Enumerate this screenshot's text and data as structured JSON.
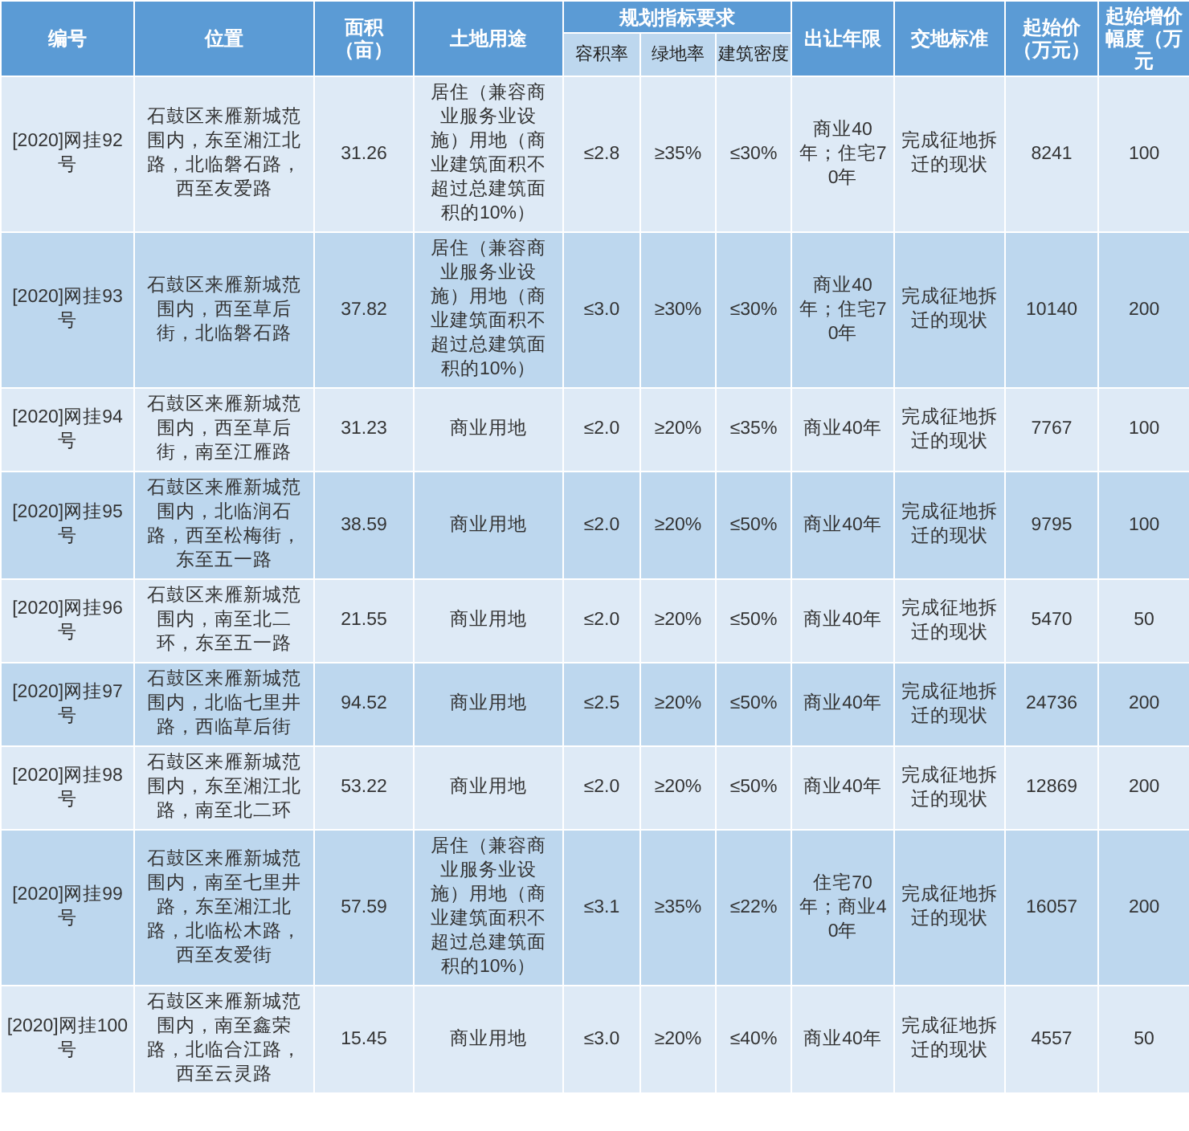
{
  "table": {
    "header_rows": [
      [
        {
          "label": "编号",
          "rowspan": 2
        },
        {
          "label": "位置",
          "rowspan": 2
        },
        {
          "label": "面积（亩）",
          "rowspan": 2
        },
        {
          "label": "土地用途",
          "rowspan": 2
        },
        {
          "label": "规划指标要求",
          "colspan": 3
        },
        {
          "label": "出让年限",
          "rowspan": 2
        },
        {
          "label": "交地标准",
          "rowspan": 2
        },
        {
          "label": "起始价（万元）",
          "rowspan": 2
        },
        {
          "label": "起始增价幅度（万元",
          "rowspan": 2
        }
      ],
      [
        {
          "label": "容积率"
        },
        {
          "label": "绿地率"
        },
        {
          "label": "建筑密度"
        }
      ]
    ],
    "rows": [
      {
        "cells": [
          "[2020]网挂92号",
          "石鼓区来雁新城范围内，东至湘江北路，北临磐石路，西至友爱路",
          "31.26",
          "居住（兼容商业服务业设施）用地（商业建筑面积不超过总建筑面积的10%）",
          "≤2.8",
          "≥35%",
          "≤30%",
          "商业40年；住宅70年",
          "完成征地拆迁的现状",
          "8241",
          "100"
        ]
      },
      {
        "cells": [
          "[2020]网挂93号",
          "石鼓区来雁新城范围内，西至草后街，北临磐石路",
          "37.82",
          "居住（兼容商业服务业设施）用地（商业建筑面积不超过总建筑面积的10%）",
          "≤3.0",
          "≥30%",
          "≤30%",
          "商业40年；住宅70年",
          "完成征地拆迁的现状",
          "10140",
          "200"
        ]
      },
      {
        "cells": [
          "[2020]网挂94号",
          "石鼓区来雁新城范围内，西至草后街，南至江雁路",
          "31.23",
          "商业用地",
          "≤2.0",
          "≥20%",
          "≤35%",
          "商业40年",
          "完成征地拆迁的现状",
          "7767",
          "100"
        ]
      },
      {
        "cells": [
          "[2020]网挂95号",
          "石鼓区来雁新城范围内，北临润石路，西至松梅街，东至五一路",
          "38.59",
          "商业用地",
          "≤2.0",
          "≥20%",
          "≤50%",
          "商业40年",
          "完成征地拆迁的现状",
          "9795",
          "100"
        ]
      },
      {
        "cells": [
          "[2020]网挂96号",
          "石鼓区来雁新城范围内，南至北二环，东至五一路",
          "21.55",
          "商业用地",
          "≤2.0",
          "≥20%",
          "≤50%",
          "商业40年",
          "完成征地拆迁的现状",
          "5470",
          "50"
        ]
      },
      {
        "cells": [
          "[2020]网挂97号",
          "石鼓区来雁新城范围内，北临七里井路，西临草后街",
          "94.52",
          "商业用地",
          "≤2.5",
          "≥20%",
          "≤50%",
          "商业40年",
          "完成征地拆迁的现状",
          "24736",
          "200"
        ]
      },
      {
        "cells": [
          "[2020]网挂98号",
          "石鼓区来雁新城范围内，东至湘江北路，南至北二环",
          "53.22",
          "商业用地",
          "≤2.0",
          "≥20%",
          "≤50%",
          "商业40年",
          "完成征地拆迁的现状",
          "12869",
          "200"
        ]
      },
      {
        "cells": [
          "[2020]网挂99号",
          "石鼓区来雁新城范围内，南至七里井路，东至湘江北路，北临松木路，西至友爱街",
          "57.59",
          "居住（兼容商业服务业设施）用地（商业建筑面积不超过总建筑面积的10%）",
          "≤3.1",
          "≥35%",
          "≤22%",
          "住宅70年；商业40年",
          "完成征地拆迁的现状",
          "16057",
          "200"
        ]
      },
      {
        "cells": [
          "[2020]网挂100号",
          "石鼓区来雁新城范围内，南至鑫荣路，北临合江路，西至云灵路",
          "15.45",
          "商业用地",
          "≤3.0",
          "≥20%",
          "≤40%",
          "商业40年",
          "完成征地拆迁的现状",
          "4557",
          "50"
        ]
      }
    ]
  }
}
